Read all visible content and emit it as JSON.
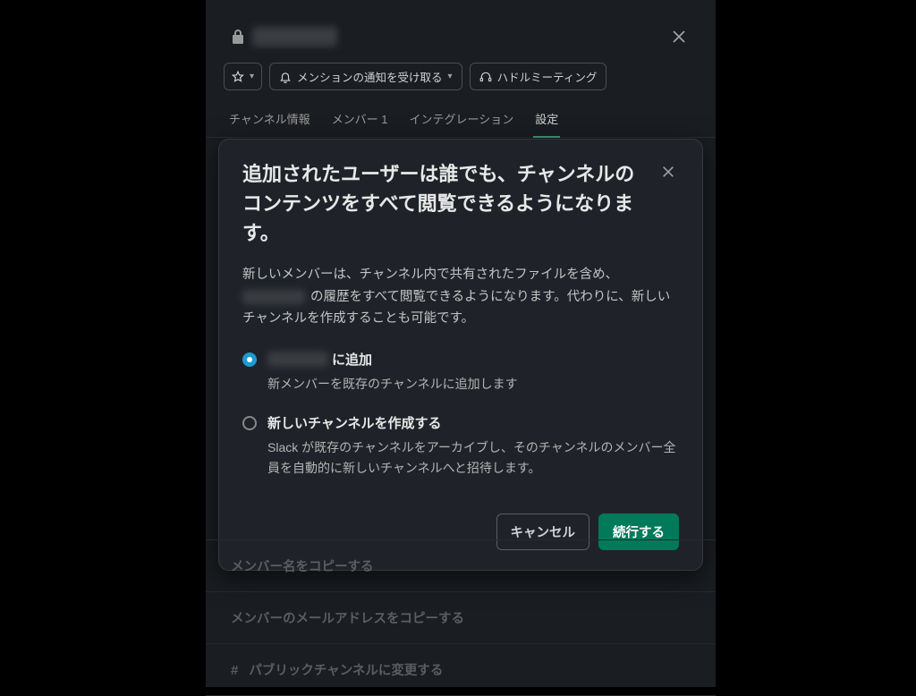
{
  "header": {
    "close_icon_name": "close-icon"
  },
  "toolbar": {
    "notify_label": "メンションの通知を受け取る",
    "huddle_label": "ハドルミーティング"
  },
  "tabs": {
    "info": "チャンネル情報",
    "members": "メンバー 1",
    "integrations": "インテグレーション",
    "settings": "設定"
  },
  "modal": {
    "title": "追加されたユーザーは誰でも、チャンネルのコンテンツをすべて閲覧できるようになります。",
    "desc_part1": "新しいメンバーは、チャンネル内で共有されたファイルを含め、",
    "desc_part2": " の履歴をすべて閲覧できるようになります。代わりに、新しいチャンネルを作成することも可能です。",
    "option1": {
      "label_suffix": "に追加",
      "sub": "新メンバーを既存のチャンネルに追加します"
    },
    "option2": {
      "label": "新しいチャンネルを作成する",
      "sub": "Slack が既存のチャンネルをアーカイブし、そのチャンネルのメンバー全員を自動的に新しいチャンネルへと招待します。"
    },
    "cancel": "キャンセル",
    "continue": "続行する"
  },
  "rows": {
    "copy_member_names": "メンバー名をコピーする",
    "copy_member_emails": "メンバーのメールアドレスをコピーする",
    "change_public": "パブリックチャンネルに変更する"
  }
}
